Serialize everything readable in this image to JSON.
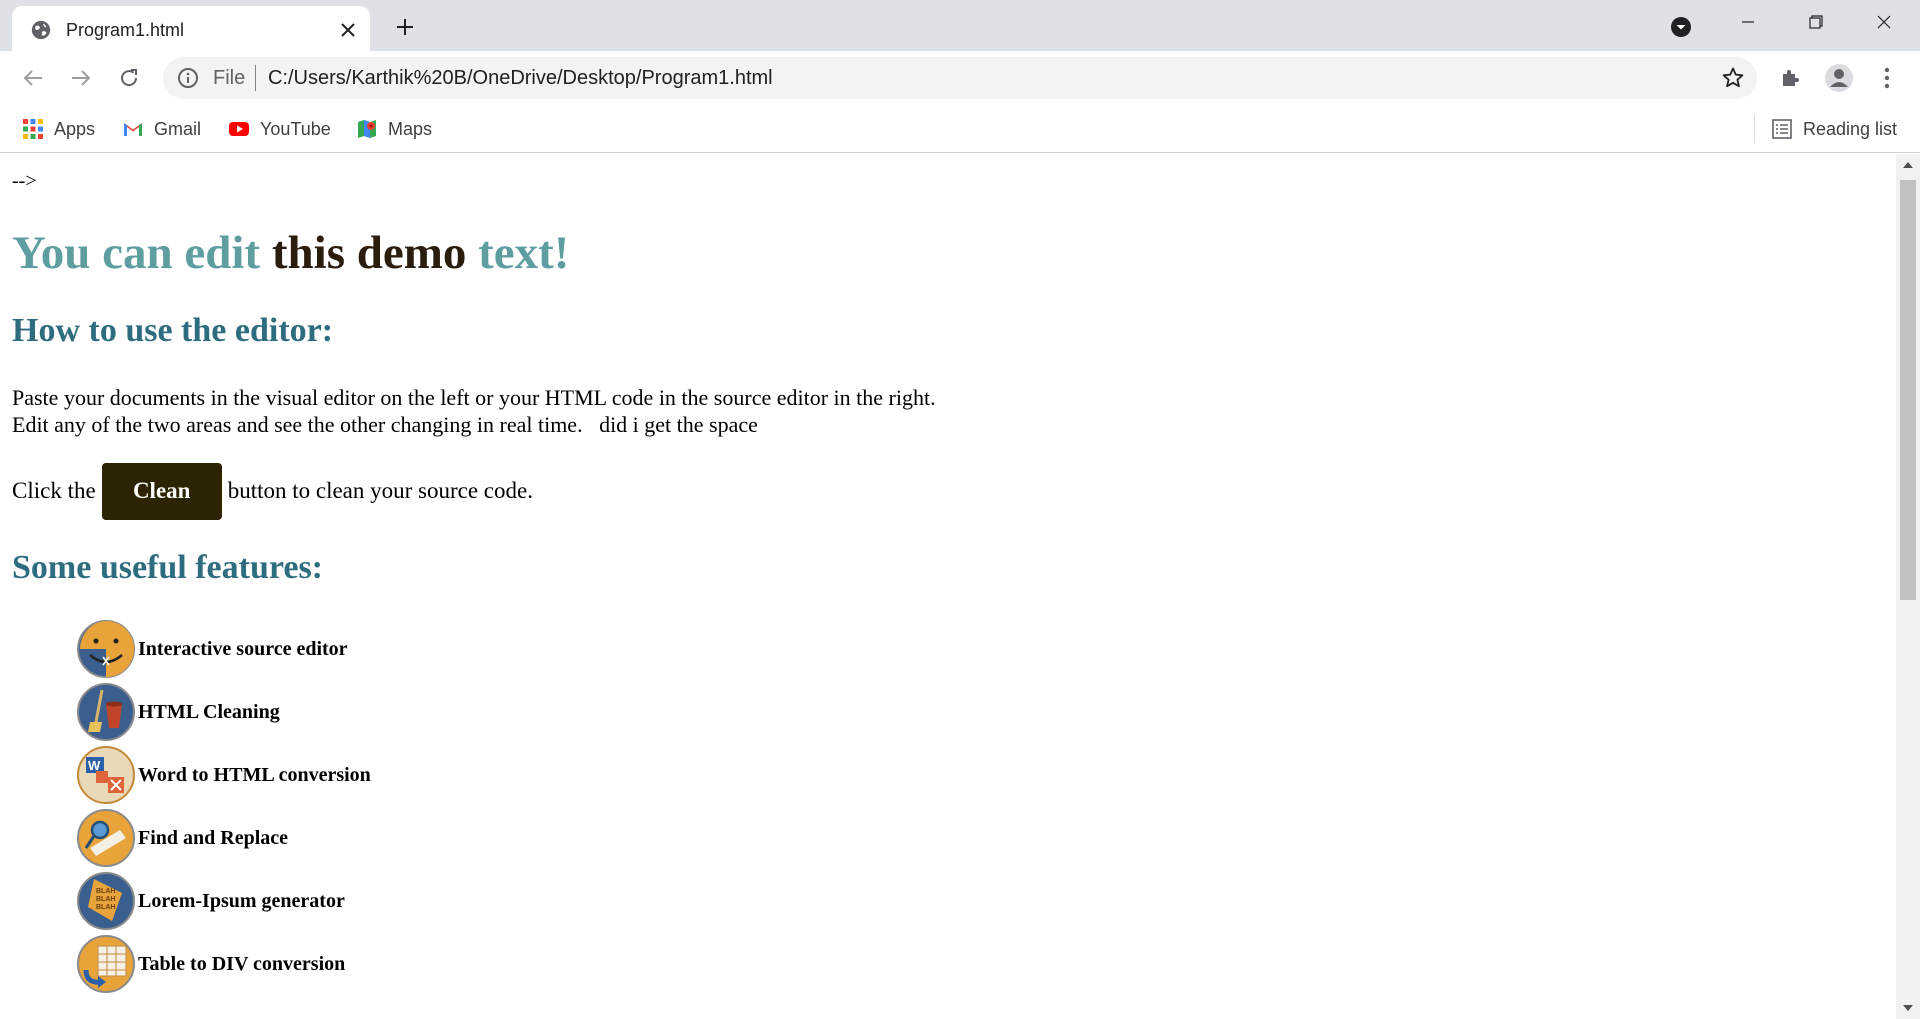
{
  "browser": {
    "tab": {
      "title": "Program1.html",
      "favicon": "globe-icon"
    },
    "toolbar": {
      "scheme_label": "File",
      "url": "C:/Users/Karthik%20B/OneDrive/Desktop/Program1.html"
    },
    "bookmarks": [
      {
        "label": "Apps",
        "icon": "apps-grid-icon"
      },
      {
        "label": "Gmail",
        "icon": "gmail-icon"
      },
      {
        "label": "YouTube",
        "icon": "youtube-icon"
      },
      {
        "label": "Maps",
        "icon": "maps-icon"
      }
    ],
    "reading_list": "Reading list"
  },
  "page": {
    "comment_leftover": "-->",
    "headline": {
      "part1": "You can edit",
      "part2": "this demo",
      "part3": "text!"
    },
    "section1_title": "How to use the editor:",
    "paragraph_line1": "Paste your documents in the visual editor on the left or your HTML code in the source editor in the right.",
    "paragraph_line2": "Edit any of the two areas and see the other changing in real time.   did i get the space",
    "clean_prefix": "Click the",
    "clean_button": "Clean",
    "clean_suffix": "button to clean your source code.",
    "section2_title": "Some useful features:",
    "features": [
      "Interactive source editor",
      "HTML Cleaning",
      "Word to HTML conversion",
      "Find and Replace",
      "Lorem-Ipsum generator",
      "Table to DIV conversion"
    ]
  },
  "colors": {
    "headline_teal": "#5f9ea0",
    "headline_dark": "#2b1d0e",
    "section_title": "#2e6c80",
    "clean_button_bg": "#2b2301"
  }
}
